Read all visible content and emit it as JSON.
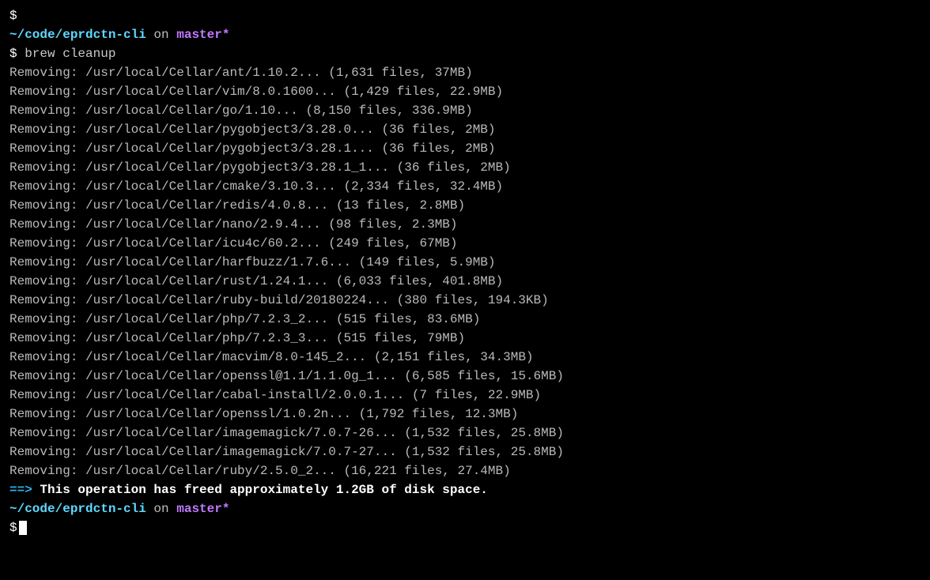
{
  "prompt": {
    "dollar": "$",
    "cwd": "~/code/eprdctn-cli",
    "on": " on ",
    "branch": "master",
    "branch_dirty": "*"
  },
  "command": "brew cleanup",
  "removing_label": "Removing: ",
  "removals": [
    {
      "path": "/usr/local/Cellar/ant/1.10.2...",
      "stats": " (1,631 files, 37MB)"
    },
    {
      "path": "/usr/local/Cellar/vim/8.0.1600...",
      "stats": " (1,429 files, 22.9MB)"
    },
    {
      "path": "/usr/local/Cellar/go/1.10...",
      "stats": " (8,150 files, 336.9MB)"
    },
    {
      "path": "/usr/local/Cellar/pygobject3/3.28.0...",
      "stats": " (36 files, 2MB)"
    },
    {
      "path": "/usr/local/Cellar/pygobject3/3.28.1...",
      "stats": " (36 files, 2MB)"
    },
    {
      "path": "/usr/local/Cellar/pygobject3/3.28.1_1...",
      "stats": " (36 files, 2MB)"
    },
    {
      "path": "/usr/local/Cellar/cmake/3.10.3...",
      "stats": " (2,334 files, 32.4MB)"
    },
    {
      "path": "/usr/local/Cellar/redis/4.0.8...",
      "stats": " (13 files, 2.8MB)"
    },
    {
      "path": "/usr/local/Cellar/nano/2.9.4...",
      "stats": " (98 files, 2.3MB)"
    },
    {
      "path": "/usr/local/Cellar/icu4c/60.2...",
      "stats": " (249 files, 67MB)"
    },
    {
      "path": "/usr/local/Cellar/harfbuzz/1.7.6...",
      "stats": " (149 files, 5.9MB)"
    },
    {
      "path": "/usr/local/Cellar/rust/1.24.1...",
      "stats": " (6,033 files, 401.8MB)"
    },
    {
      "path": "/usr/local/Cellar/ruby-build/20180224...",
      "stats": " (380 files, 194.3KB)"
    },
    {
      "path": "/usr/local/Cellar/php/7.2.3_2...",
      "stats": " (515 files, 83.6MB)"
    },
    {
      "path": "/usr/local/Cellar/php/7.2.3_3...",
      "stats": " (515 files, 79MB)"
    },
    {
      "path": "/usr/local/Cellar/macvim/8.0-145_2...",
      "stats": " (2,151 files, 34.3MB)"
    },
    {
      "path": "/usr/local/Cellar/openssl@1.1/1.1.0g_1...",
      "stats": " (6,585 files, 15.6MB)"
    },
    {
      "path": "/usr/local/Cellar/cabal-install/2.0.0.1...",
      "stats": " (7 files, 22.9MB)"
    },
    {
      "path": "/usr/local/Cellar/openssl/1.0.2n...",
      "stats": " (1,792 files, 12.3MB)"
    },
    {
      "path": "/usr/local/Cellar/imagemagick/7.0.7-26...",
      "stats": " (1,532 files, 25.8MB)"
    },
    {
      "path": "/usr/local/Cellar/imagemagick/7.0.7-27...",
      "stats": " (1,532 files, 25.8MB)"
    },
    {
      "path": "/usr/local/Cellar/ruby/2.5.0_2...",
      "stats": " (16,221 files, 27.4MB)"
    }
  ],
  "summary": {
    "arrow": "==> ",
    "text": "This operation has freed approximately 1.2GB of disk space."
  }
}
